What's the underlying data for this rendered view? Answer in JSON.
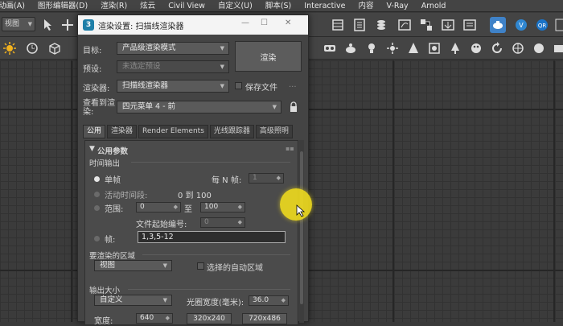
{
  "menubar": {
    "items": [
      "动画(A)",
      "图形编辑器(D)",
      "渲染(R)",
      "炫云",
      "Civil View",
      "自定义(U)",
      "脚本(S)",
      "Interactive",
      "内容",
      "V-Ray",
      "Arnold"
    ]
  },
  "toolbar": {
    "view_dropdown": "视图",
    "icons": [
      "select-icon",
      "scale-icon",
      "layer-icon",
      "explorer-icon",
      "material-icon",
      "render-setup-icon",
      "render-icon",
      "teapot-icon",
      "vray-icon",
      "qr-icon",
      "grid-icon"
    ]
  },
  "dialog": {
    "title": "渲染设置: 扫描线渲染器",
    "target_label": "目标:",
    "target_value": "产品级渲染模式",
    "preset_label": "预设:",
    "preset_value": "未选定预设",
    "renderer_label": "渲染器:",
    "renderer_value": "扫描线渲染器",
    "save_file_label": "保存文件",
    "more_label": "...",
    "view_label_1": "查看到渲",
    "view_label_2": "染:",
    "view_value": "四元菜单 4 - 前",
    "render_button": "渲染",
    "tabs": [
      "公用",
      "渲染器",
      "Render Elements",
      "光线跟踪器",
      "高级照明"
    ],
    "active_tab": 0
  },
  "common": {
    "rollout_title": "公用参数",
    "time_output": {
      "title": "时间输出",
      "single": "单帧",
      "every_n_label": "每 N 帧:",
      "every_n_value": "1",
      "active_segment": "活动时间段:",
      "active_range": "0 到 100",
      "range_label": "范围:",
      "range_from": "0",
      "range_to_label": "至",
      "range_to": "100",
      "file_number_label": "文件起始编号:",
      "file_number_value": "0",
      "frames_label": "帧:",
      "frames_value": "1,3,5-12"
    },
    "render_area": {
      "title": "要渲染的区域",
      "area_value": "视图",
      "auto_region": "选择的自动区域"
    },
    "output_size": {
      "title": "输出大小",
      "size_preset": "自定义",
      "aperture_label": "光圈宽度(毫米):",
      "aperture_value": "36.0",
      "width_label": "宽度:",
      "width_value": "640",
      "preset1": "320x240",
      "preset2": "720x486"
    }
  },
  "viewport": {
    "corner_label": "["
  }
}
